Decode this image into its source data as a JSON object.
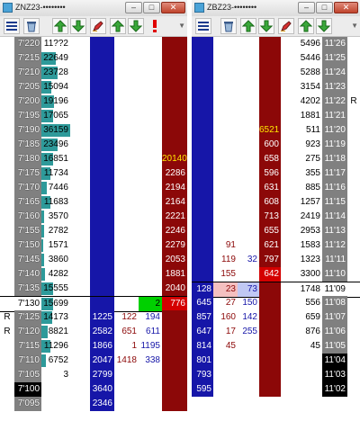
{
  "colors": {
    "price_bg": "#808080",
    "price_bg_dark": "#000000",
    "price_fg": "#ffffff",
    "bid_col": "#1616a8",
    "ask_col": "#8c0808",
    "vol_bar": "#2e9a9a",
    "ask_red": "#d40000",
    "ask_pink": "#f4c0c0",
    "bid_light": "#c0c8f4",
    "yellow": "#ffe800",
    "green_fill": "#00d000"
  },
  "icons": [
    "center-ladder-icon",
    "recycle-icon",
    "scroll-up-icon",
    "scroll-down-icon",
    "pen-icon",
    "alert-icon"
  ],
  "left": {
    "title": "ZNZ23-••••••••",
    "rows": [
      {
        "flag": "",
        "price": "7'220",
        "vol": "11??2",
        "vbar": 0.0,
        "bid": "",
        "buy": "",
        "sell": "",
        "ask": ""
      },
      {
        "flag": "",
        "price": "7'215",
        "vol": "22649",
        "vbar": 0.5,
        "bid": "",
        "buy": "",
        "sell": "",
        "ask": ""
      },
      {
        "flag": "",
        "price": "7'210",
        "vol": "23728",
        "vbar": 0.55,
        "bid": "",
        "buy": "",
        "sell": "",
        "ask": ""
      },
      {
        "flag": "",
        "price": "7'205",
        "vol": "15094",
        "vbar": 0.35,
        "bid": "",
        "buy": "",
        "sell": "",
        "ask": ""
      },
      {
        "flag": "",
        "price": "7'200",
        "vol": "19196",
        "vbar": 0.45,
        "bid": "",
        "buy": "",
        "sell": "",
        "ask": ""
      },
      {
        "flag": "",
        "price": "7'195",
        "vol": "17065",
        "vbar": 0.4,
        "bid": "",
        "buy": "",
        "sell": "",
        "ask": ""
      },
      {
        "flag": "",
        "price": "7'190",
        "vol": "36159",
        "vbar": 1.0,
        "bid": "",
        "buy": "",
        "sell": "",
        "ask": ""
      },
      {
        "flag": "",
        "price": "7'185",
        "vol": "23496",
        "vbar": 0.55,
        "bid": "",
        "buy": "",
        "sell": "",
        "ask": ""
      },
      {
        "flag": "",
        "price": "7'180",
        "vol": "16851",
        "vbar": 0.4,
        "bid": "",
        "buy": "",
        "sell": "",
        "ask": "20140",
        "askstyle": "yellow"
      },
      {
        "flag": "",
        "price": "7'175",
        "vol": "11734",
        "vbar": 0.3,
        "bid": "",
        "buy": "",
        "sell": "",
        "ask": "2286"
      },
      {
        "flag": "",
        "price": "7'170",
        "vol": "7446",
        "vbar": 0.18,
        "bid": "",
        "buy": "",
        "sell": "",
        "ask": "2194"
      },
      {
        "flag": "",
        "price": "7'165",
        "vol": "11683",
        "vbar": 0.3,
        "bid": "",
        "buy": "",
        "sell": "",
        "ask": "2164"
      },
      {
        "flag": "",
        "price": "7'160",
        "vol": "3570",
        "vbar": 0.1,
        "bid": "",
        "buy": "",
        "sell": "",
        "ask": "2221"
      },
      {
        "flag": "",
        "price": "7'155",
        "vol": "2782",
        "vbar": 0.08,
        "bid": "",
        "buy": "",
        "sell": "",
        "ask": "2246"
      },
      {
        "flag": "",
        "price": "7'150",
        "vol": "1571",
        "vbar": 0.05,
        "bid": "",
        "buy": "",
        "sell": "",
        "ask": "2279"
      },
      {
        "flag": "",
        "price": "7'145",
        "vol": "3860",
        "vbar": 0.1,
        "bid": "",
        "buy": "",
        "sell": "",
        "ask": "2053"
      },
      {
        "flag": "",
        "price": "7'140",
        "vol": "4282",
        "vbar": 0.12,
        "bid": "",
        "buy": "",
        "sell": "",
        "ask": "1881"
      },
      {
        "flag": "",
        "price": "7'135",
        "vol": "15555",
        "vbar": 0.4,
        "bid": "",
        "buy": "",
        "sell": "",
        "ask": "2040"
      },
      {
        "flag": "",
        "price": "7'130",
        "vol": "15699",
        "vbar": 0.4,
        "bid": "",
        "buy": "",
        "sell": "2",
        "ask": "776",
        "current": true,
        "sellstyle": "green",
        "askstyle": "red"
      },
      {
        "flag": "R",
        "price": "7'125",
        "vol": "14173",
        "vbar": 0.38,
        "bid": "1225",
        "buy": "122",
        "sell": "194",
        "ask": ""
      },
      {
        "flag": "R",
        "price": "7'120",
        "vol": "8821",
        "vbar": 0.22,
        "bid": "2582",
        "buy": "651",
        "sell": "611",
        "ask": ""
      },
      {
        "flag": "",
        "price": "7'115",
        "vol": "11296",
        "vbar": 0.3,
        "bid": "1866",
        "buy": "1",
        "sell": "1195",
        "ask": ""
      },
      {
        "flag": "",
        "price": "7'110",
        "vol": "6752",
        "vbar": 0.17,
        "bid": "2047",
        "buy": "1418",
        "sell": "338",
        "ask": ""
      },
      {
        "flag": "",
        "price": "7'105",
        "vol": "3",
        "vbar": 0.0,
        "bid": "2799",
        "buy": "",
        "sell": "",
        "ask": ""
      },
      {
        "flag": "",
        "price": "7'100",
        "vol": "",
        "vbar": 0.0,
        "bid": "3640",
        "buy": "",
        "sell": "",
        "ask": "",
        "dark": true
      },
      {
        "flag": "",
        "price": "7'095",
        "vol": "",
        "vbar": 0.0,
        "bid": "2346",
        "buy": "",
        "sell": "",
        "ask": ""
      }
    ]
  },
  "right": {
    "title": "ZBZ23-••••••••",
    "rows": [
      {
        "bid": "",
        "buy": "",
        "sell": "",
        "ask": "",
        "vol": "5496",
        "price": "11'26",
        "flag": ""
      },
      {
        "bid": "",
        "buy": "",
        "sell": "",
        "ask": "",
        "vol": "5446",
        "price": "11'25",
        "flag": ""
      },
      {
        "bid": "",
        "buy": "",
        "sell": "",
        "ask": "",
        "vol": "5288",
        "price": "11'24",
        "flag": ""
      },
      {
        "bid": "",
        "buy": "",
        "sell": "",
        "ask": "",
        "vol": "3154",
        "price": "11'23",
        "flag": ""
      },
      {
        "bid": "",
        "buy": "",
        "sell": "",
        "ask": "",
        "vol": "4202",
        "price": "11'22",
        "flag": "R"
      },
      {
        "bid": "",
        "buy": "",
        "sell": "",
        "ask": "",
        "vol": "1881",
        "price": "11'21",
        "flag": ""
      },
      {
        "bid": "",
        "buy": "",
        "sell": "",
        "ask": "6521",
        "askstyle": "yellow",
        "vol": "511",
        "price": "11'20",
        "flag": ""
      },
      {
        "bid": "",
        "buy": "",
        "sell": "",
        "ask": "600",
        "vol": "923",
        "price": "11'19",
        "flag": ""
      },
      {
        "bid": "",
        "buy": "",
        "sell": "",
        "ask": "658",
        "vol": "275",
        "price": "11'18",
        "flag": ""
      },
      {
        "bid": "",
        "buy": "",
        "sell": "",
        "ask": "596",
        "vol": "355",
        "price": "11'17",
        "flag": ""
      },
      {
        "bid": "",
        "buy": "",
        "sell": "",
        "ask": "631",
        "vol": "885",
        "price": "11'16",
        "flag": ""
      },
      {
        "bid": "",
        "buy": "",
        "sell": "",
        "ask": "608",
        "vol": "1257",
        "price": "11'15",
        "flag": ""
      },
      {
        "bid": "",
        "buy": "",
        "sell": "",
        "ask": "713",
        "vol": "2419",
        "price": "11'14",
        "flag": ""
      },
      {
        "bid": "",
        "buy": "",
        "sell": "",
        "ask": "655",
        "vol": "2953",
        "price": "11'13",
        "flag": ""
      },
      {
        "bid": "",
        "buy": "91",
        "sell": "",
        "ask": "621",
        "vol": "1583",
        "price": "11'12",
        "flag": ""
      },
      {
        "bid": "",
        "buy": "119",
        "sell": "32",
        "ask": "797",
        "vol": "1323",
        "price": "11'11",
        "flag": ""
      },
      {
        "bid": "",
        "buy": "155",
        "sell": "",
        "ask": "642",
        "askstyle": "red",
        "sellstyle": "white",
        "vol": "3300",
        "price": "11'10",
        "flag": ""
      },
      {
        "bid": "128",
        "buy": "23",
        "sell": "73",
        "ask": "",
        "buystyle": "pink",
        "sellstyle": "lightblue",
        "vol": "1748",
        "price": "11'09",
        "flag": "",
        "current": true
      },
      {
        "bid": "645",
        "buy": "27",
        "sell": "150",
        "ask": "",
        "vol": "556",
        "price": "11'08",
        "flag": ""
      },
      {
        "bid": "857",
        "buy": "160",
        "sell": "142",
        "ask": "",
        "vol": "659",
        "price": "11'07",
        "flag": ""
      },
      {
        "bid": "647",
        "buy": "17",
        "sell": "255",
        "ask": "",
        "vol": "876",
        "price": "11'06",
        "flag": ""
      },
      {
        "bid": "814",
        "buy": "45",
        "sell": "",
        "ask": "",
        "vol": "45",
        "price": "11'05",
        "flag": ""
      },
      {
        "bid": "801",
        "buy": "",
        "sell": "",
        "ask": "",
        "vol": "",
        "price": "11'04",
        "flag": "",
        "dark": true
      },
      {
        "bid": "793",
        "buy": "",
        "sell": "",
        "ask": "",
        "vol": "",
        "price": "11'03",
        "flag": "",
        "dark": true
      },
      {
        "bid": "595",
        "buy": "",
        "sell": "",
        "ask": "",
        "vol": "",
        "price": "11'02",
        "flag": "",
        "dark": true
      }
    ]
  }
}
